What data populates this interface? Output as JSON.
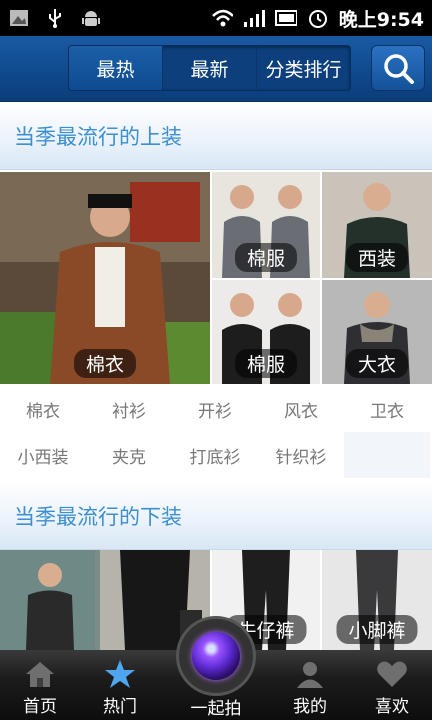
{
  "status": {
    "time": "晚上9:54"
  },
  "header": {
    "tabs": [
      {
        "label": "最热",
        "active": true
      },
      {
        "label": "最新",
        "active": false
      },
      {
        "label": "分类排行",
        "active": false
      }
    ],
    "search_icon": "search-icon"
  },
  "sections": [
    {
      "title": "当季最流行的上装",
      "photos": [
        {
          "caption": "棉衣"
        },
        {
          "caption": "棉服"
        },
        {
          "caption": "西装"
        },
        {
          "caption": "棉服"
        },
        {
          "caption": "大衣"
        }
      ],
      "categories": [
        "棉衣",
        "衬衫",
        "开衫",
        "风衣",
        "卫衣",
        "小西装",
        "夹克",
        "打底衫",
        "针织衫"
      ]
    },
    {
      "title": "当季最流行的下装",
      "photos": [
        {
          "caption": ""
        },
        {
          "caption": ""
        },
        {
          "caption": "牛仔裤"
        },
        {
          "caption": "小脚裤"
        }
      ]
    }
  ],
  "bottom_nav": {
    "items": [
      {
        "label": "首页",
        "icon": "home-icon"
      },
      {
        "label": "热门",
        "icon": "star-icon"
      },
      {
        "label": "一起拍",
        "icon": "camera-icon"
      },
      {
        "label": "我的",
        "icon": "person-icon"
      },
      {
        "label": "喜欢",
        "icon": "heart-icon"
      }
    ]
  },
  "colors": {
    "header_blue": "#0f4a8e",
    "section_title": "#3d8fcf",
    "nav_bg": "#1c1c1c"
  }
}
